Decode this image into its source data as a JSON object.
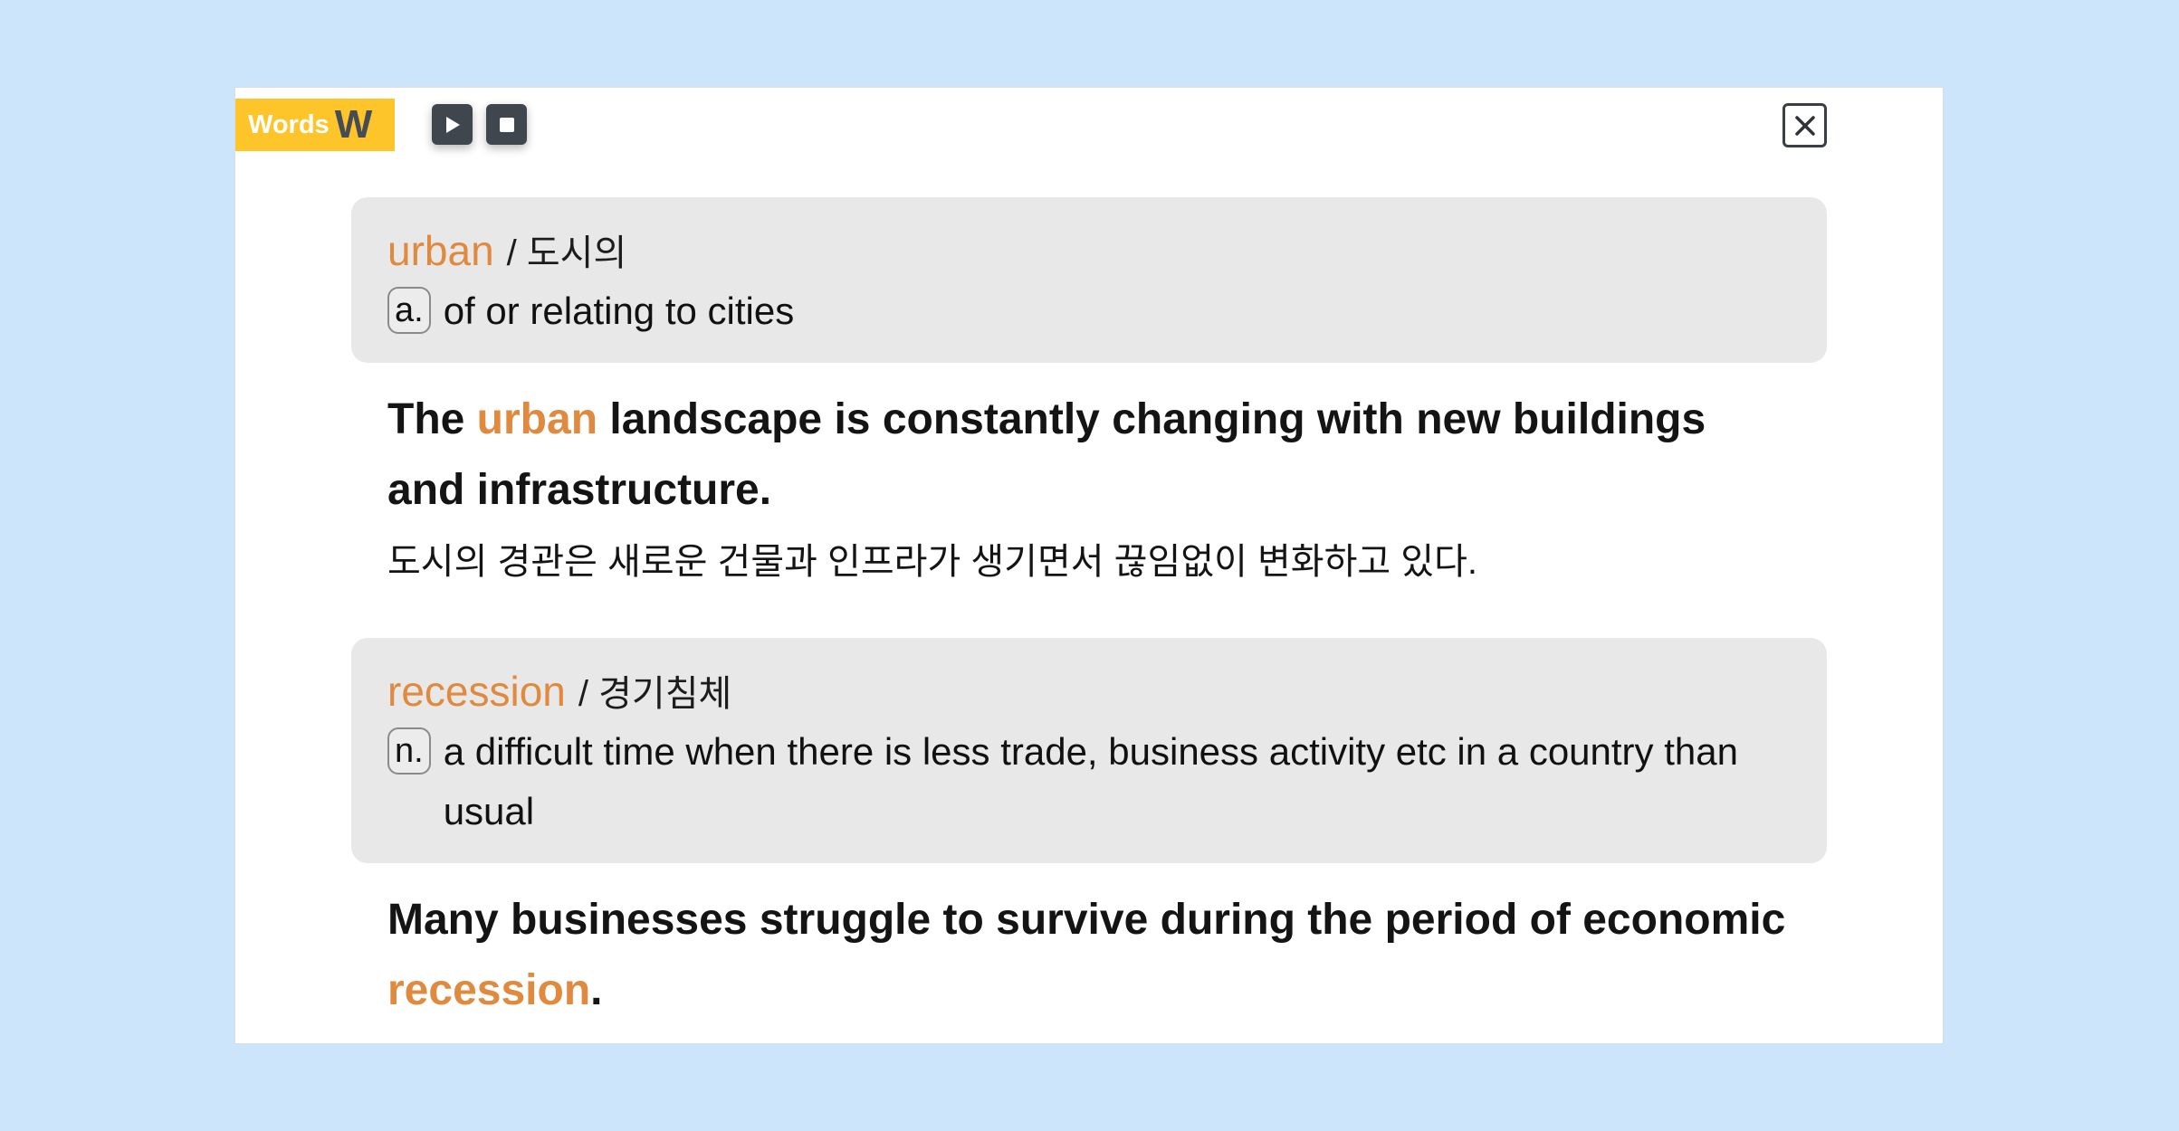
{
  "header": {
    "badge_text": "Words",
    "badge_letter": "W",
    "play_icon": "play-icon",
    "stop_icon": "stop-icon",
    "close_icon": "close-icon"
  },
  "entries": [
    {
      "word": "urban",
      "korean": "/ 도시의",
      "pos": "a.",
      "definition": "of or relating to cities",
      "example_before": "The ",
      "example_word": "urban",
      "example_after": " landscape is constantly changing with new buildings and infrastructure.",
      "translation": "도시의 경관은 새로운 건물과 인프라가 생기면서 끊임없이 변화하고 있다."
    },
    {
      "word": "recession",
      "korean": "/ 경기침체",
      "pos": "n.",
      "definition": "a difficult time when there is less trade, business activity etc in a country than usual",
      "example_before": "Many businesses struggle to survive during the period of economic ",
      "example_word": "recession",
      "example_after": "."
    }
  ],
  "colors": {
    "accent": "#e08a3f",
    "badge": "#fdc52a",
    "background": "#cce5fb",
    "card": "#e8e8e8"
  }
}
